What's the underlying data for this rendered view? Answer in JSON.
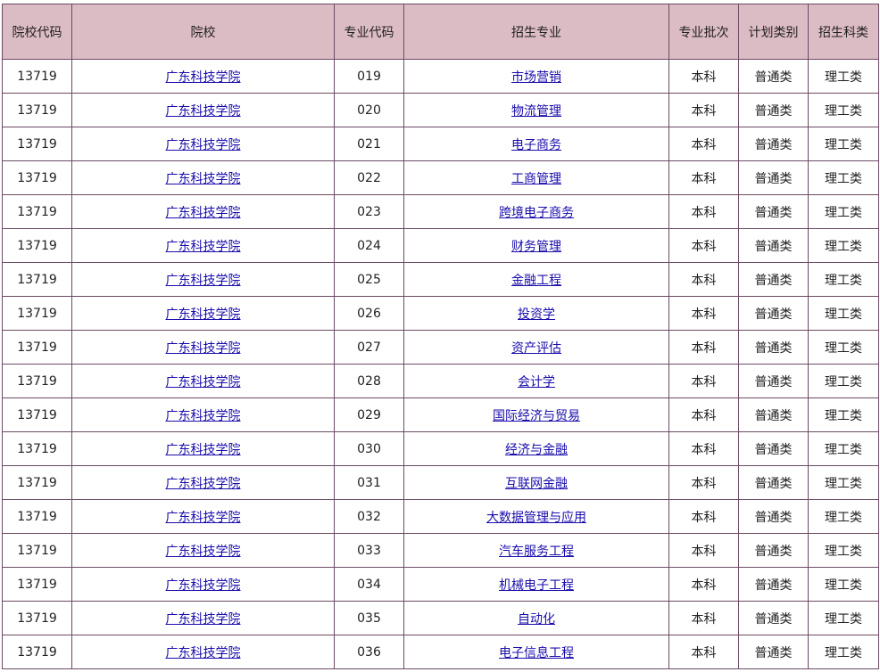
{
  "colors": {
    "header_bg": "#dcbcc4",
    "border": "#6b4a63",
    "link": "#1a0dab"
  },
  "table": {
    "headers": [
      "院校代码",
      "院校",
      "专业代码",
      "招生专业",
      "专业批次",
      "计划类别",
      "招生科类"
    ],
    "rows": [
      [
        "13719",
        "广东科技学院",
        "019",
        "市场营销",
        "本科",
        "普通类",
        "理工类"
      ],
      [
        "13719",
        "广东科技学院",
        "020",
        "物流管理",
        "本科",
        "普通类",
        "理工类"
      ],
      [
        "13719",
        "广东科技学院",
        "021",
        "电子商务",
        "本科",
        "普通类",
        "理工类"
      ],
      [
        "13719",
        "广东科技学院",
        "022",
        "工商管理",
        "本科",
        "普通类",
        "理工类"
      ],
      [
        "13719",
        "广东科技学院",
        "023",
        "跨境电子商务",
        "本科",
        "普通类",
        "理工类"
      ],
      [
        "13719",
        "广东科技学院",
        "024",
        "财务管理",
        "本科",
        "普通类",
        "理工类"
      ],
      [
        "13719",
        "广东科技学院",
        "025",
        "金融工程",
        "本科",
        "普通类",
        "理工类"
      ],
      [
        "13719",
        "广东科技学院",
        "026",
        "投资学",
        "本科",
        "普通类",
        "理工类"
      ],
      [
        "13719",
        "广东科技学院",
        "027",
        "资产评估",
        "本科",
        "普通类",
        "理工类"
      ],
      [
        "13719",
        "广东科技学院",
        "028",
        "会计学",
        "本科",
        "普通类",
        "理工类"
      ],
      [
        "13719",
        "广东科技学院",
        "029",
        "国际经济与贸易",
        "本科",
        "普通类",
        "理工类"
      ],
      [
        "13719",
        "广东科技学院",
        "030",
        "经济与金融",
        "本科",
        "普通类",
        "理工类"
      ],
      [
        "13719",
        "广东科技学院",
        "031",
        "互联网金融",
        "本科",
        "普通类",
        "理工类"
      ],
      [
        "13719",
        "广东科技学院",
        "032",
        "大数据管理与应用",
        "本科",
        "普通类",
        "理工类"
      ],
      [
        "13719",
        "广东科技学院",
        "033",
        "汽车服务工程",
        "本科",
        "普通类",
        "理工类"
      ],
      [
        "13719",
        "广东科技学院",
        "034",
        "机械电子工程",
        "本科",
        "普通类",
        "理工类"
      ],
      [
        "13719",
        "广东科技学院",
        "035",
        "自动化",
        "本科",
        "普通类",
        "理工类"
      ],
      [
        "13719",
        "广东科技学院",
        "036",
        "电子信息工程",
        "本科",
        "普通类",
        "理工类"
      ]
    ]
  }
}
